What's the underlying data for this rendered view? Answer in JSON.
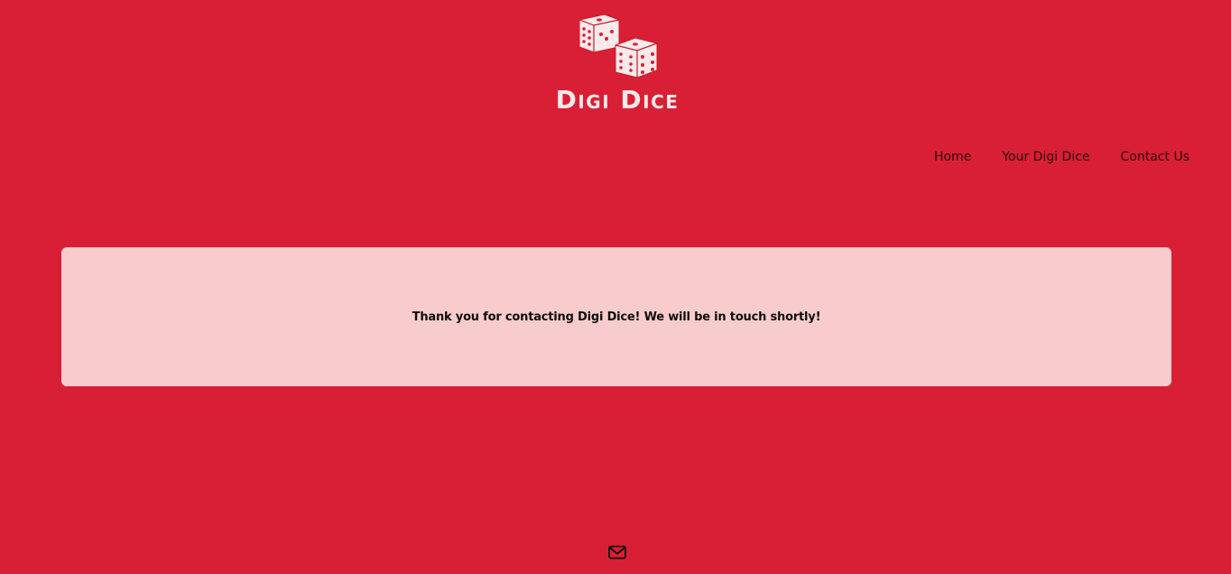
{
  "brand": {
    "name": "Digi Dice",
    "logo_icon": "dice-icon"
  },
  "nav": {
    "items": [
      {
        "label": "Home"
      },
      {
        "label": "Your Digi Dice"
      },
      {
        "label": "Contact Us"
      }
    ]
  },
  "main": {
    "message": "Thank you for contacting Digi Dice! We will be in touch shortly!"
  },
  "footer": {
    "icon": "envelope-icon"
  },
  "colors": {
    "background": "#d91f35",
    "card": "#f8cccc",
    "logo": "#f9e9e9",
    "text": "#0d0d0d"
  }
}
